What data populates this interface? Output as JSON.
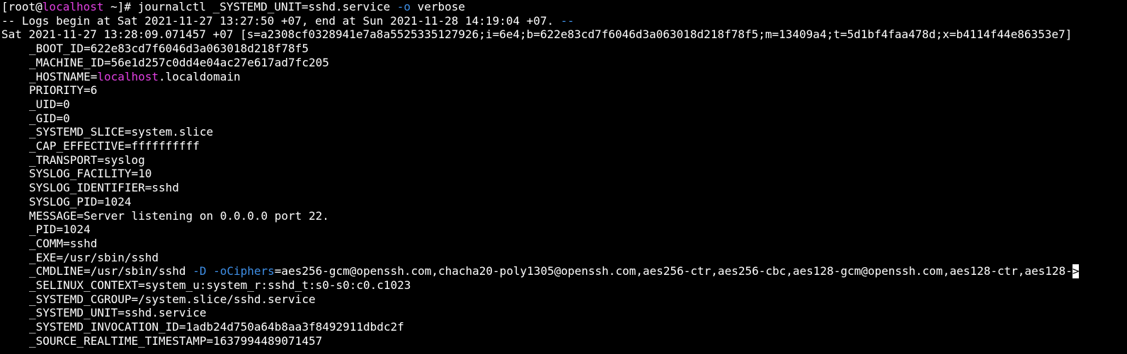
{
  "colors": {
    "background": "#000000",
    "text": "#ffffff",
    "highlight_magenta": "#e040e0",
    "highlight_blue": "#3f8fe6"
  },
  "partial_top_line": "                                                         ",
  "prompt": {
    "open": "[root@",
    "host": "localhost",
    "rest": " ~]# ",
    "command": "journalctl _SYSTEMD_UNIT=sshd.service ",
    "flag": "-o",
    "arg": " verbose"
  },
  "logs_begin": {
    "text": "-- Logs begin at Sat 2021-11-27 13:27:50 +07, end at Sun 2021-11-28 14:19:04 +07. ",
    "tail": "--"
  },
  "entry_header": "Sat 2021-11-27 13:28:09.071457 +07 [s=a2308cf0328941e7a8a5525335127926;i=6e4;b=622e83cd7f6046d3a063018d218f78f5;m=13409a4;t=5d1bf4faa478d;x=b4114f44e86353e7]",
  "fields": [
    {
      "text": "_BOOT_ID=622e83cd7f6046d3a063018d218f78f5"
    },
    {
      "text": "_MACHINE_ID=56e1d257c0dd4e04ac27e617ad7fc205"
    },
    {
      "pre": "_HOSTNAME=",
      "host": "localhost",
      "post": ".localdomain"
    },
    {
      "text": "PRIORITY=6"
    },
    {
      "text": "_UID=0"
    },
    {
      "text": "_GID=0"
    },
    {
      "text": "_SYSTEMD_SLICE=system.slice"
    },
    {
      "text": "_CAP_EFFECTIVE=ffffffffff"
    },
    {
      "text": "_TRANSPORT=syslog"
    },
    {
      "text": "SYSLOG_FACILITY=10"
    },
    {
      "text": "SYSLOG_IDENTIFIER=sshd"
    },
    {
      "text": "SYSLOG_PID=1024"
    },
    {
      "text": "MESSAGE=Server listening on 0.0.0.0 port 22."
    },
    {
      "text": "_PID=1024"
    },
    {
      "text": "_COMM=sshd"
    },
    {
      "text": "_EXE=/usr/sbin/sshd"
    },
    {
      "pre": "_CMDLINE=/usr/sbin/sshd ",
      "opt1": "-D",
      "sp": " ",
      "opt2": "-oCiphers",
      "post": "=aes256-gcm@openssh.com,chacha20-poly1305@openssh.com,aes256-ctr,aes256-cbc,aes128-gcm@openssh.com,aes128-ctr,aes128-",
      "cursor": ">"
    },
    {
      "text": "_SELINUX_CONTEXT=system_u:system_r:sshd_t:s0-s0:c0.c1023"
    },
    {
      "text": "_SYSTEMD_CGROUP=/system.slice/sshd.service"
    },
    {
      "text": "_SYSTEMD_UNIT=sshd.service"
    },
    {
      "text": "_SYSTEMD_INVOCATION_ID=1adb24d750a64b8aa3f8492911dbdc2f"
    },
    {
      "text": "_SOURCE_REALTIME_TIMESTAMP=1637994489071457"
    }
  ]
}
